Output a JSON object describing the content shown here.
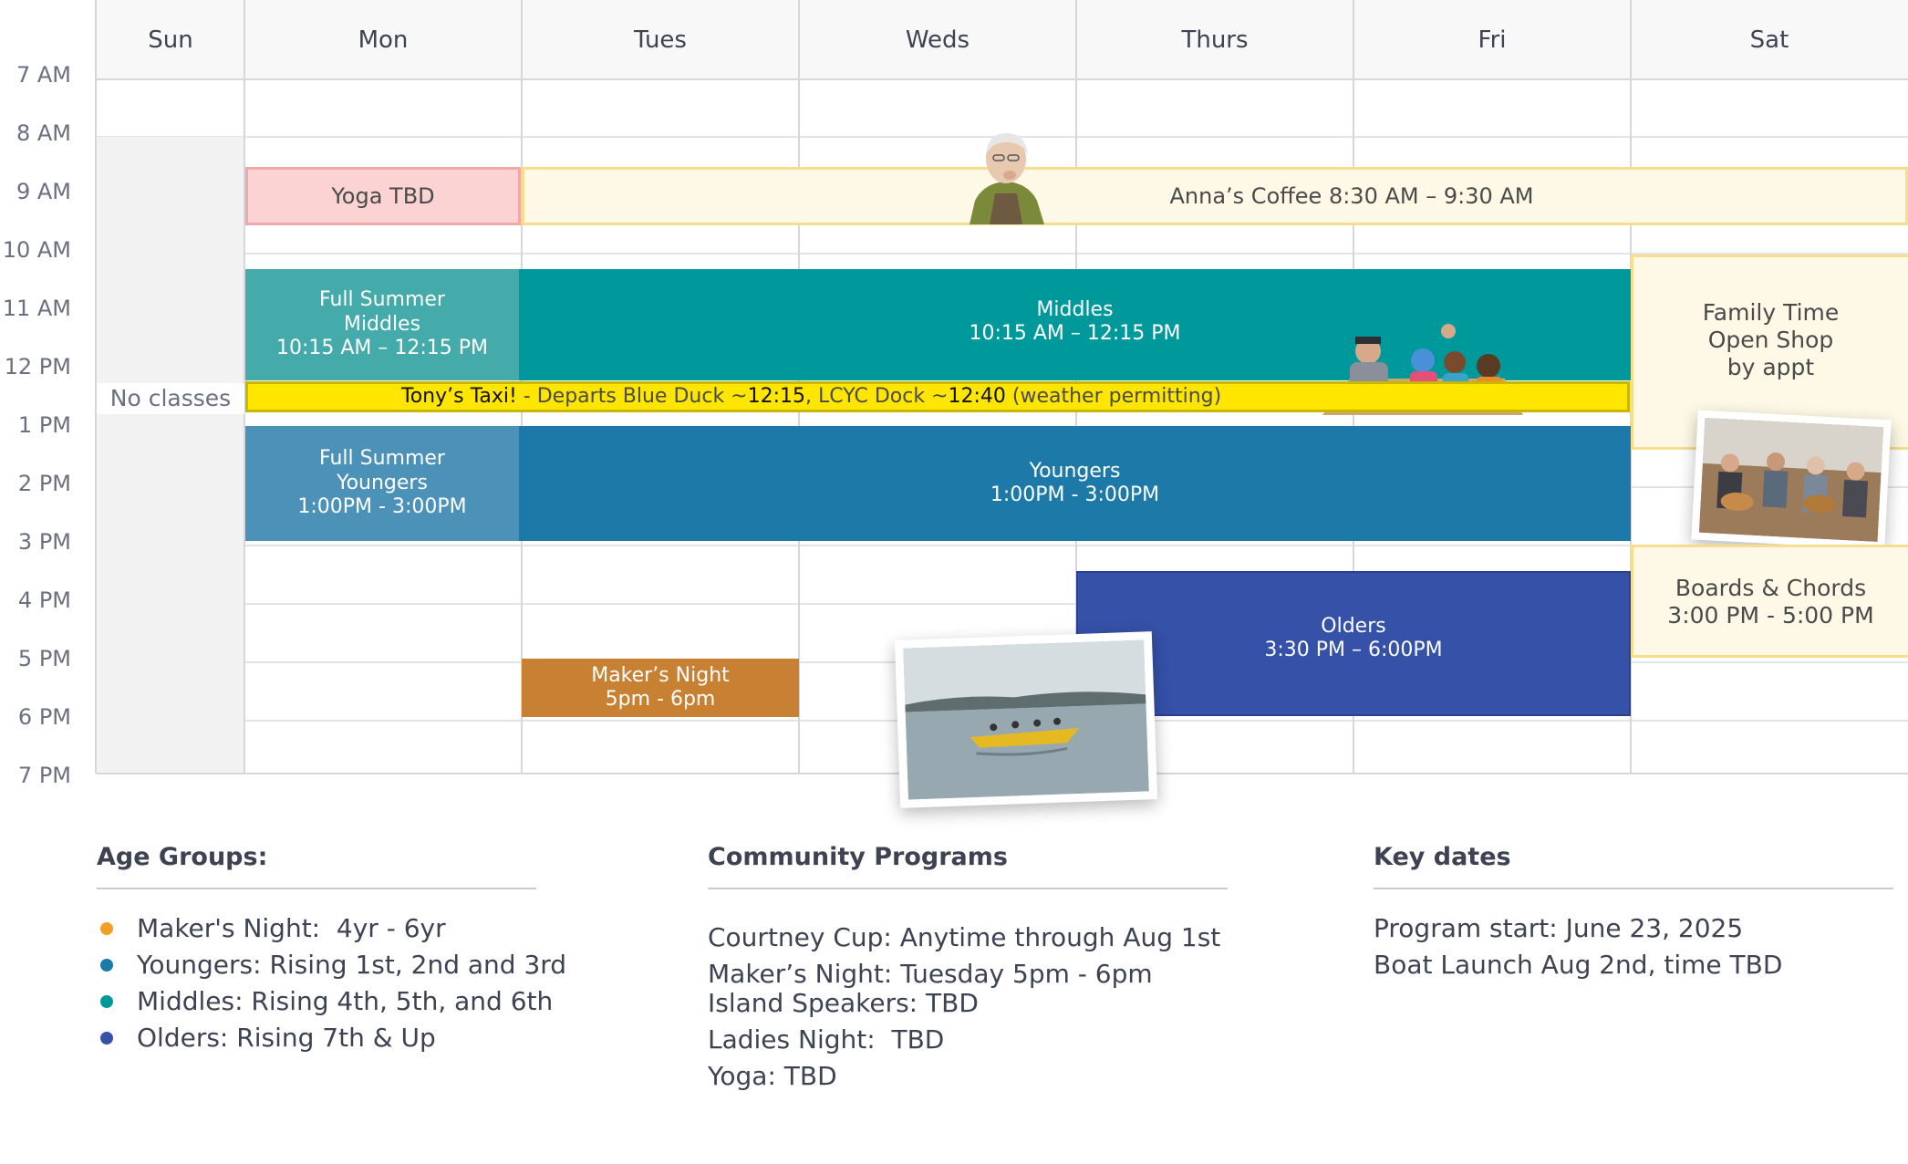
{
  "days": [
    "Sun",
    "Mon",
    "Tues",
    "Weds",
    "Thurs",
    "Fri",
    "Sat"
  ],
  "hours": [
    "7 AM",
    "8 AM",
    "9 AM",
    "10 AM",
    "11 AM",
    "12 PM",
    "1 PM",
    "2 PM",
    "3 PM",
    "4 PM",
    "5 PM",
    "6 PM",
    "7 PM"
  ],
  "events": {
    "no_classes": "No classes",
    "yoga": "Yoga TBD",
    "coffee": "Anna’s Coffee 8:30 AM – 9:30 AM",
    "full_middles": [
      "Full Summer",
      "Middles",
      "10:15 AM – 12:15 PM"
    ],
    "middles": [
      "Middles",
      "10:15 AM – 12:15 PM"
    ],
    "family": [
      "Family Time",
      "Open Shop",
      "by appt"
    ],
    "taxi": {
      "bold": "Tony’s Taxi!",
      "a": "  - Departs Blue Duck ~",
      "t1": "12:15",
      "b": ", LCYC Dock ~",
      "t2": "12:40",
      "c": " (weather permitting)"
    },
    "full_youngers": [
      "Full Summer",
      "Youngers",
      "1:00PM - 3:00PM"
    ],
    "youngers": [
      "Youngers",
      "1:00PM - 3:00PM"
    ],
    "boards": [
      "Boards & Chords",
      "3:00 PM - 5:00 PM"
    ],
    "olders": [
      "Olders",
      "3:30 PM – 6:00PM"
    ],
    "makers": [
      "Maker’s Night",
      "5pm - 6pm"
    ]
  },
  "age_groups": {
    "title": "Age Groups:",
    "items": [
      {
        "label": "Maker's Night:  4yr - 6yr",
        "color": "#f0a023"
      },
      {
        "label": "Youngers: Rising 1st, 2nd and 3rd",
        "color": "#1d79a8"
      },
      {
        "label": "Middles: Rising 4th, 5th, and 6th",
        "color": "#00999b"
      },
      {
        "label": "Olders: Rising 7th & Up",
        "color": "#3551a8"
      }
    ]
  },
  "community": {
    "title": "Community Programs",
    "items": [
      "Courtney Cup: Anytime through Aug 1st",
      "Maker’s Night: Tuesday 5pm - 6pm",
      "Island Speakers: TBD",
      "Ladies Night:  TBD",
      "Yoga: TBD"
    ]
  },
  "key_dates": {
    "title": "Key dates",
    "items": [
      "Program start: June 23, 2025",
      "Boat Launch Aug 2nd, time TBD"
    ]
  },
  "colors": {
    "yoga": "#fcd3d3",
    "coffee": "#fef8e6",
    "middles": "#00999b",
    "full_middles": "#44aaaa",
    "taxi": "#ffe600",
    "youngers": "#1d79a8",
    "full_youngers": "#4c92b8",
    "olders": "#3551a8",
    "makers": "#c88132",
    "family": "#fef8e6",
    "no_classes": "#f2f2f2"
  }
}
